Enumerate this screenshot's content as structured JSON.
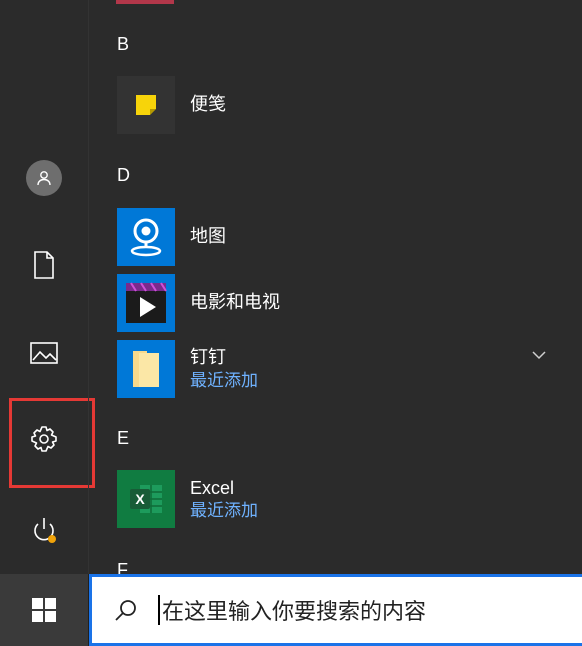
{
  "start_menu": {
    "sections": [
      {
        "letter": "B"
      },
      {
        "letter": "D"
      },
      {
        "letter": "E"
      }
    ],
    "apps": [
      {
        "name": "便笺",
        "sub": ""
      },
      {
        "name": "地图",
        "sub": ""
      },
      {
        "name": "电影和电视",
        "sub": ""
      },
      {
        "name": "钉钉",
        "sub": "最近添加"
      },
      {
        "name": "Excel",
        "sub": "最近添加"
      }
    ]
  },
  "taskbar": {
    "search_placeholder": "在这里输入你要搜索的内容"
  },
  "colors": {
    "accent_blue": "#1a73e8",
    "tile_blue": "#0078d7",
    "excel_green": "#107c41",
    "highlight_red": "#e53935",
    "recently_added": "#6fb2ff"
  }
}
